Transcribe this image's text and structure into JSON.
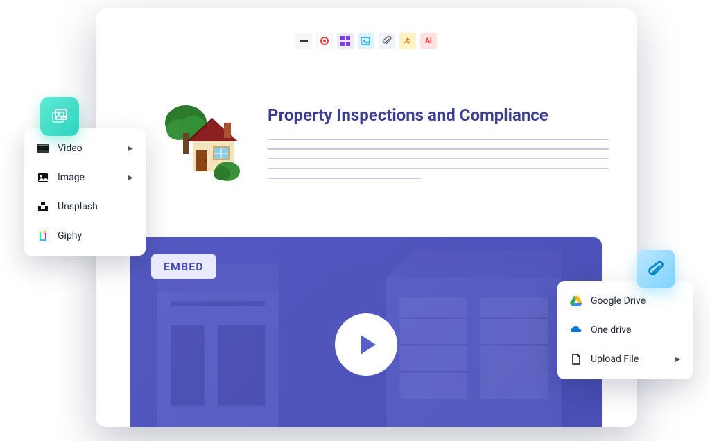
{
  "toolbar": {
    "items": [
      "dash",
      "record",
      "grid",
      "media",
      "attach",
      "embed",
      "ai"
    ],
    "ai_label": "AI"
  },
  "doc": {
    "title": "Property Inspections and Compliance"
  },
  "embed": {
    "badge": "EMBED"
  },
  "media_menu": {
    "items": [
      {
        "label": "Video",
        "has_submenu": true
      },
      {
        "label": "Image",
        "has_submenu": true
      },
      {
        "label": "Unsplash",
        "has_submenu": false
      },
      {
        "label": "Giphy",
        "has_submenu": false
      }
    ]
  },
  "attach_menu": {
    "items": [
      {
        "label": "Google Drive",
        "has_submenu": false
      },
      {
        "label": "One drive",
        "has_submenu": false
      },
      {
        "label": "Upload File",
        "has_submenu": true
      }
    ]
  }
}
